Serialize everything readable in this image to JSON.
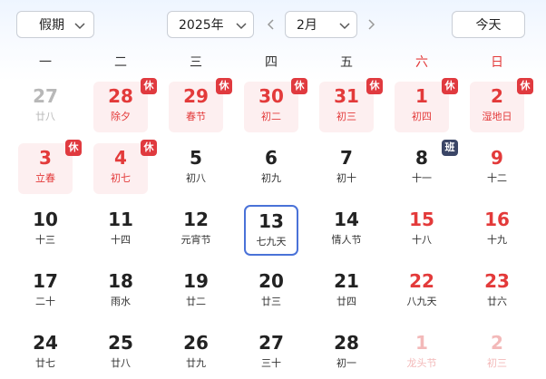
{
  "toolbar": {
    "holiday_select": "假期",
    "year_select": "2025年",
    "month_select": "2月",
    "today_label": "今天"
  },
  "weekdays": [
    "一",
    "二",
    "三",
    "四",
    "五",
    "六",
    "日"
  ],
  "badges": {
    "rest": "休",
    "work": "班"
  },
  "colors": {
    "accent": "#4a72d8",
    "holiday_red": "#e33a3a",
    "rest_bg": "#fdeff0",
    "work_badge": "#3a4566"
  },
  "days": [
    {
      "day": "27",
      "lunar": "廿八",
      "other": true
    },
    {
      "day": "28",
      "lunar": "除夕",
      "rest": true,
      "badge": "rest"
    },
    {
      "day": "29",
      "lunar": "春节",
      "rest": true,
      "badge": "rest"
    },
    {
      "day": "30",
      "lunar": "初二",
      "rest": true,
      "badge": "rest"
    },
    {
      "day": "31",
      "lunar": "初三",
      "rest": true,
      "badge": "rest"
    },
    {
      "day": "1",
      "lunar": "初四",
      "rest": true,
      "badge": "rest"
    },
    {
      "day": "2",
      "lunar": "湿地日",
      "rest": true,
      "badge": "rest"
    },
    {
      "day": "3",
      "lunar": "立春",
      "rest": true,
      "badge": "rest"
    },
    {
      "day": "4",
      "lunar": "初七",
      "rest": true,
      "badge": "rest"
    },
    {
      "day": "5",
      "lunar": "初八"
    },
    {
      "day": "6",
      "lunar": "初九"
    },
    {
      "day": "7",
      "lunar": "初十"
    },
    {
      "day": "8",
      "lunar": "十一",
      "badge": "work"
    },
    {
      "day": "9",
      "lunar": "十二",
      "weekend": true
    },
    {
      "day": "10",
      "lunar": "十三"
    },
    {
      "day": "11",
      "lunar": "十四"
    },
    {
      "day": "12",
      "lunar": "元宵节"
    },
    {
      "day": "13",
      "lunar": "七九天",
      "today": true
    },
    {
      "day": "14",
      "lunar": "情人节"
    },
    {
      "day": "15",
      "lunar": "十八",
      "weekend": true
    },
    {
      "day": "16",
      "lunar": "十九",
      "weekend": true
    },
    {
      "day": "17",
      "lunar": "二十"
    },
    {
      "day": "18",
      "lunar": "雨水"
    },
    {
      "day": "19",
      "lunar": "廿二"
    },
    {
      "day": "20",
      "lunar": "廿三"
    },
    {
      "day": "21",
      "lunar": "廿四"
    },
    {
      "day": "22",
      "lunar": "八九天",
      "weekend": true
    },
    {
      "day": "23",
      "lunar": "廿六",
      "weekend": true
    },
    {
      "day": "24",
      "lunar": "廿七"
    },
    {
      "day": "25",
      "lunar": "廿八"
    },
    {
      "day": "26",
      "lunar": "廿九"
    },
    {
      "day": "27",
      "lunar": "三十"
    },
    {
      "day": "28",
      "lunar": "初一"
    },
    {
      "day": "1",
      "lunar": "龙头节",
      "other": true,
      "weekend": true
    },
    {
      "day": "2",
      "lunar": "初三",
      "other": true,
      "weekend": true
    }
  ]
}
